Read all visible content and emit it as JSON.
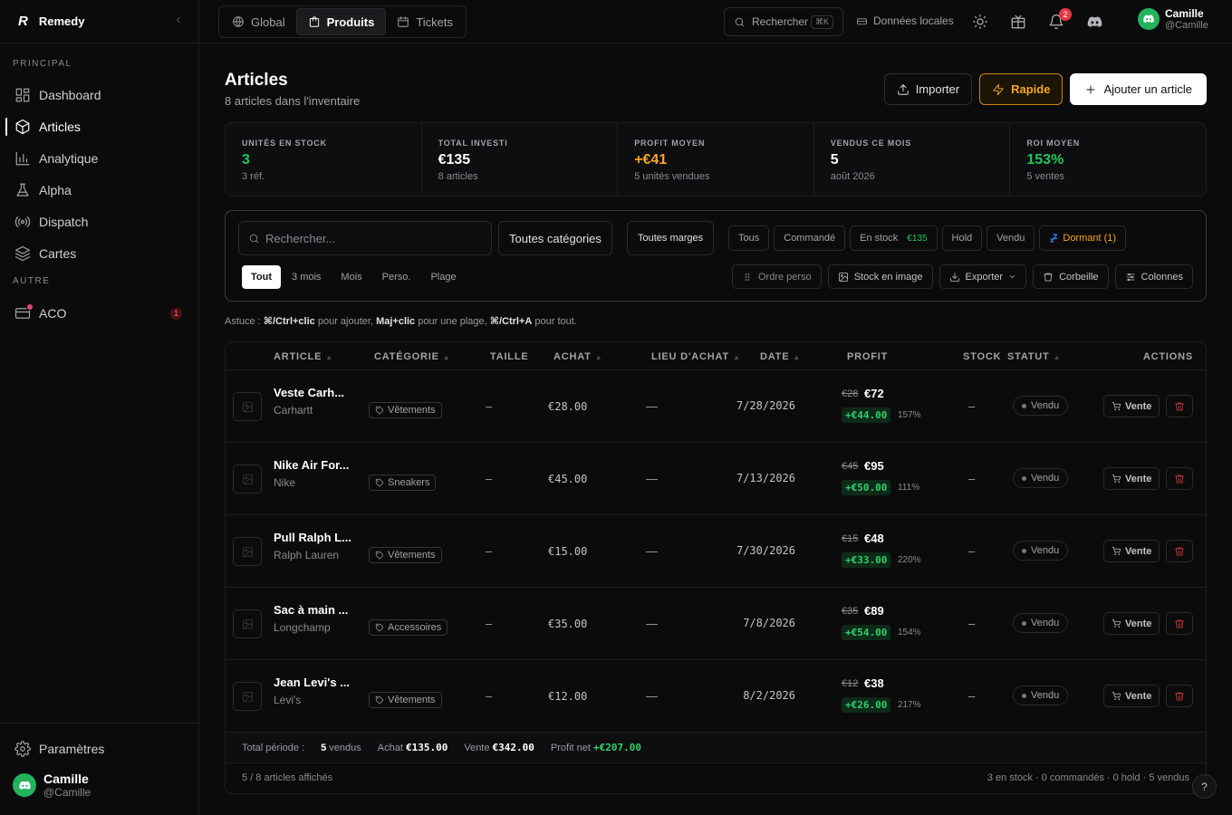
{
  "brand": {
    "logo": "R",
    "name": "Remedy"
  },
  "sidebar": {
    "principal_label": "PRINCIPAL",
    "items": [
      {
        "label": "Dashboard"
      },
      {
        "label": "Articles"
      },
      {
        "label": "Analytique"
      },
      {
        "label": "Alpha"
      },
      {
        "label": "Dispatch"
      },
      {
        "label": "Cartes"
      }
    ],
    "autre_label": "AUTRE",
    "aco": {
      "label": "ACO",
      "badge": "1"
    },
    "settings_label": "Paramètres",
    "user": {
      "name": "Camille",
      "handle": "@Camille"
    }
  },
  "topbar": {
    "tabs": [
      {
        "label": "Global"
      },
      {
        "label": "Produits"
      },
      {
        "label": "Tickets"
      }
    ],
    "search_label": "Rechercher",
    "search_kbd": "⌘K",
    "local_data": "Données locales",
    "notif_count": "2",
    "user": {
      "name": "Camille",
      "handle": "@Camille"
    }
  },
  "page": {
    "title": "Articles",
    "subtitle": "8 articles dans l'inventaire",
    "import_label": "Importer",
    "quick_label": "Rapide",
    "add_label": "Ajouter un article"
  },
  "stats": [
    {
      "label": "UNITÉS EN STOCK",
      "value": "3",
      "sub": "3 réf.",
      "color": "#22c55e"
    },
    {
      "label": "TOTAL INVESTI",
      "value": "€135",
      "sub": "8 articles",
      "color": "#ffffff"
    },
    {
      "label": "PROFIT MOYEN",
      "value": "+€41",
      "sub": "5 unités vendues",
      "color": "#f5a623"
    },
    {
      "label": "VENDUS CE MOIS",
      "value": "5",
      "sub": "août 2026",
      "color": "#ffffff"
    },
    {
      "label": "ROI MOYEN",
      "value": "153%",
      "sub": "5 ventes",
      "color": "#22c55e"
    }
  ],
  "filters": {
    "search_placeholder": "Rechercher...",
    "category": "Toutes catégories",
    "margins": "Toutes marges",
    "chips": [
      {
        "label": "Tous"
      },
      {
        "label": "Commandé"
      },
      {
        "label": "En stock",
        "count": "€135"
      },
      {
        "label": "Hold"
      },
      {
        "label": "Vendu"
      },
      {
        "label": "Dormant (1)"
      }
    ],
    "periods": [
      "Tout",
      "3 mois",
      "Mois",
      "Perso.",
      "Plage"
    ],
    "tools": [
      "Ordre perso",
      "Stock en image",
      "Exporter",
      "Corbeille",
      "Colonnes"
    ]
  },
  "hint": {
    "p1": "Astuce : ",
    "k1": "⌘/Ctrl+clic",
    "p2": " pour ajouter, ",
    "k2": "Maj+clic",
    "p3": " pour une plage, ",
    "k3": "⌘/Ctrl+A",
    "p4": " pour tout."
  },
  "table": {
    "headers": [
      "ARTICLE",
      "CATÉGORIE",
      "TAILLE",
      "ACHAT",
      "LIEU D'ACHAT",
      "DATE",
      "PROFIT",
      "STOCK",
      "STATUT",
      "ACTIONS"
    ],
    "rows": [
      {
        "name": "Veste Carh...",
        "brand": "Carhartt",
        "category": "Vêtements",
        "size": "–",
        "buy": "€28.00",
        "place": "—",
        "date": "7/28/2026",
        "old": "€28",
        "sell": "€72",
        "gain": "+€44.00",
        "pct": "157%",
        "stock": "–",
        "status": "Vendu",
        "action": "Vente"
      },
      {
        "name": "Nike Air For...",
        "brand": "Nike",
        "category": "Sneakers",
        "size": "–",
        "buy": "€45.00",
        "place": "—",
        "date": "7/13/2026",
        "old": "€45",
        "sell": "€95",
        "gain": "+€50.00",
        "pct": "111%",
        "stock": "–",
        "status": "Vendu",
        "action": "Vente"
      },
      {
        "name": "Pull Ralph L...",
        "brand": "Ralph Lauren",
        "category": "Vêtements",
        "size": "–",
        "buy": "€15.00",
        "place": "—",
        "date": "7/30/2026",
        "old": "€15",
        "sell": "€48",
        "gain": "+€33.00",
        "pct": "220%",
        "stock": "–",
        "status": "Vendu",
        "action": "Vente"
      },
      {
        "name": "Sac à main ...",
        "brand": "Longchamp",
        "category": "Accessoires",
        "size": "–",
        "buy": "€35.00",
        "place": "—",
        "date": "7/8/2026",
        "old": "€35",
        "sell": "€89",
        "gain": "+€54.00",
        "pct": "154%",
        "stock": "–",
        "status": "Vendu",
        "action": "Vente"
      },
      {
        "name": "Jean Levi's ...",
        "brand": "Levi's",
        "category": "Vêtements",
        "size": "–",
        "buy": "€12.00",
        "place": "—",
        "date": "8/2/2026",
        "old": "€12",
        "sell": "€38",
        "gain": "+€26.00",
        "pct": "217%",
        "stock": "–",
        "status": "Vendu",
        "action": "Vente"
      }
    ],
    "totals": {
      "label": "Total période :",
      "sold_count": "5",
      "sold_label": "vendus",
      "buy_label": "Achat",
      "buy": "€135.00",
      "sale_label": "Vente",
      "sale": "€342.00",
      "net_label": "Profit net",
      "net": "+€207.00"
    },
    "footer_left": "5 / 8 articles affichés",
    "footer_right": "3 en stock · 0 commandés · 0 hold · 5 vendus"
  },
  "help": "?"
}
